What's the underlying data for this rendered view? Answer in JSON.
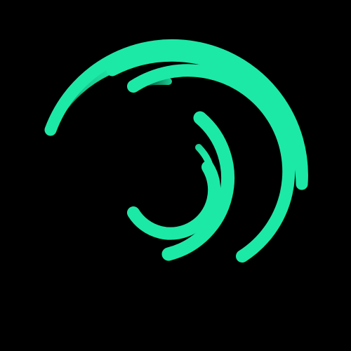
{
  "logo": {
    "icon": "swirl-arcs-logo-icon",
    "background_color": "#000000",
    "accent_color": "#1de9a6",
    "arc_count": 3
  }
}
